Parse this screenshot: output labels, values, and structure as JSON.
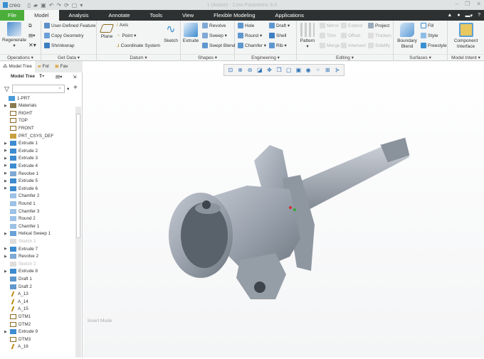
{
  "app": {
    "logo": "creo",
    "title": "1 (Active) - Creo Parametric 6.0"
  },
  "tabs": [
    "File",
    "Model",
    "Analysis",
    "Annotate",
    "Tools",
    "View",
    "Flexible Modeling",
    "Applications"
  ],
  "ribbon": {
    "operations": {
      "label": "Operations ▾",
      "regenerate": "Regenerate"
    },
    "getdata": {
      "label": "Get Data ▾",
      "items": [
        "User-Defined Feature",
        "Copy Geometry",
        "Shrinkwrap"
      ]
    },
    "datum": {
      "label": "Datum ▾",
      "plane": "Plane",
      "items": [
        "Axis",
        "Point ▾",
        "Coordinate System"
      ],
      "sketch": "Sketch"
    },
    "shapes": {
      "label": "Shapes ▾",
      "extrude": "Extrude",
      "items": [
        "Revolve",
        "Sweep ▾",
        "Swept Blend"
      ]
    },
    "engineering": {
      "label": "Engineering ▾",
      "items": [
        "Hole",
        "Round ▾",
        "Chamfer ▾",
        "Draft ▾",
        "Shell",
        "Rib ▾"
      ]
    },
    "editing": {
      "label": "Editing ▾",
      "pattern": "Pattern",
      "items": [
        "Mirror",
        "Trim",
        "Merge",
        "Extend",
        "Offset",
        "Intersect",
        "Project",
        "Thicken",
        "Solidify"
      ]
    },
    "surfaces": {
      "label": "Surfaces ▾",
      "boundary": "Boundary Blend",
      "items": [
        "Fill",
        "Style",
        "Freestyle"
      ]
    },
    "intent": {
      "label": "Model Intent ▾",
      "component": "Component Interface"
    }
  },
  "nav": {
    "tabs": [
      "Model Tree",
      "Fol",
      "Fav"
    ],
    "header": "Model Tree"
  },
  "tree": [
    {
      "t": "1-PRT",
      "k": "part",
      "e": false
    },
    {
      "t": "Materials",
      "k": "mat",
      "e": true
    },
    {
      "t": "RIGHT",
      "k": "plane"
    },
    {
      "t": "TOP",
      "k": "plane"
    },
    {
      "t": "FRONT",
      "k": "plane"
    },
    {
      "t": "PRT_CSYS_DEF",
      "k": "csys"
    },
    {
      "t": "Extrude 1",
      "k": "ext",
      "e": true
    },
    {
      "t": "Extrude 2",
      "k": "ext",
      "e": true
    },
    {
      "t": "Extrude 3",
      "k": "ext",
      "e": true
    },
    {
      "t": "Extrude 4",
      "k": "ext",
      "e": true
    },
    {
      "t": "Revolve 1",
      "k": "rev",
      "e": true
    },
    {
      "t": "Extrude 5",
      "k": "ext",
      "e": true
    },
    {
      "t": "Extrude 6",
      "k": "ext",
      "e": true
    },
    {
      "t": "Chamfer 2",
      "k": "rnd"
    },
    {
      "t": "Round 1",
      "k": "rnd"
    },
    {
      "t": "Chamfer 3",
      "k": "rnd"
    },
    {
      "t": "Round 2",
      "k": "rnd"
    },
    {
      "t": "Chamfer 1",
      "k": "rnd"
    },
    {
      "t": "Helical Sweep 1",
      "k": "hel",
      "e": true
    },
    {
      "t": "Sketch 1",
      "k": "sk",
      "dim": true
    },
    {
      "t": "Extrude 7",
      "k": "ext",
      "e": true
    },
    {
      "t": "Revolve 2",
      "k": "rev",
      "e": true
    },
    {
      "t": "Sketch 2",
      "k": "sk",
      "dim": true
    },
    {
      "t": "Extrude 8",
      "k": "ext",
      "e": true
    },
    {
      "t": "Draft 1",
      "k": "drf"
    },
    {
      "t": "Draft 2",
      "k": "drf"
    },
    {
      "t": "A_13",
      "k": "axis"
    },
    {
      "t": "A_14",
      "k": "axis"
    },
    {
      "t": "A_15",
      "k": "axis"
    },
    {
      "t": "DTM1",
      "k": "plane"
    },
    {
      "t": "DTM2",
      "k": "plane"
    },
    {
      "t": "Extrude 9",
      "k": "ext",
      "e": true
    },
    {
      "t": "DTM3",
      "k": "plane"
    },
    {
      "t": "A_16",
      "k": "axis"
    }
  ],
  "status": {
    "mode": "Insert Mode"
  },
  "colors": {
    "file": "#4bae3a",
    "tabbar": "#2e3131",
    "part": "#9aa2ad"
  }
}
